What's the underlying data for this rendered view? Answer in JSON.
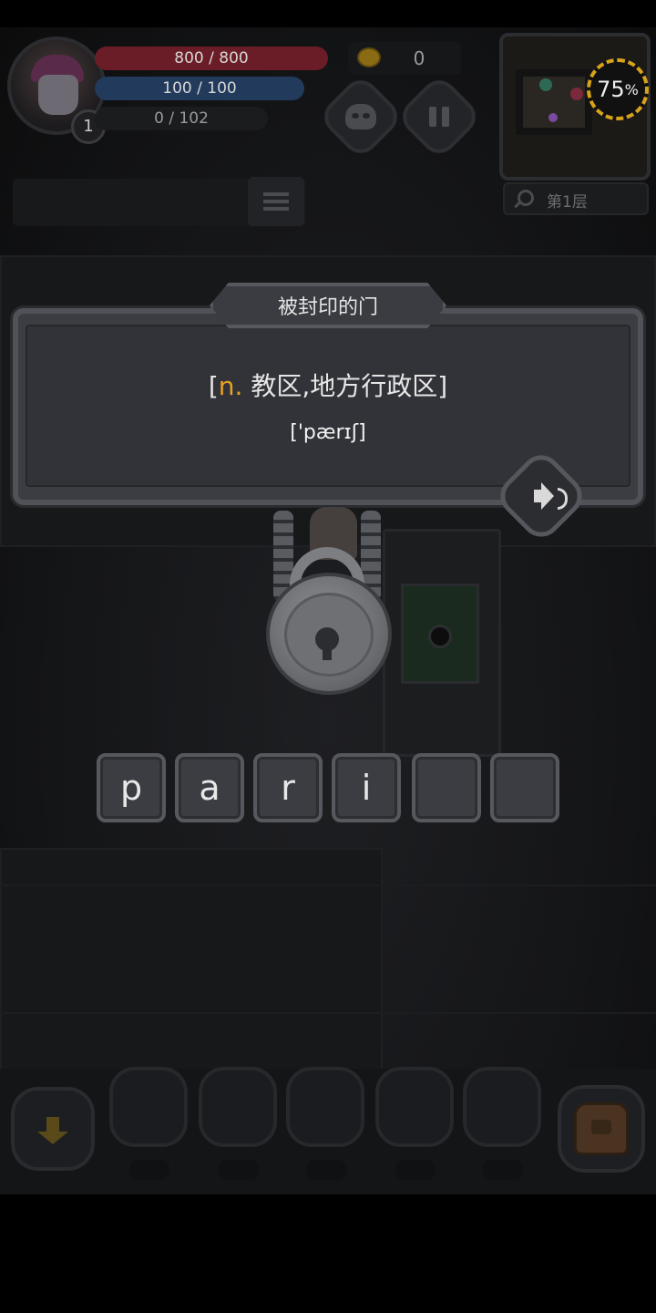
{
  "hud": {
    "hp": "800 / 800",
    "mp": "100 / 100",
    "xp": "0 / 102",
    "level": "1",
    "gold": "0",
    "progress_value": "75",
    "progress_unit": "%",
    "floor": "第1层"
  },
  "dialog": {
    "title": "被封印的门",
    "bracket_open": "[",
    "part_of_speech": "n.",
    "meaning": " 教区,地方行政区",
    "bracket_close": "]",
    "phonetic": "['pærɪʃ]"
  },
  "word_tiles": [
    {
      "letter": "p"
    },
    {
      "letter": "a"
    },
    {
      "letter": "r"
    },
    {
      "letter": "i"
    },
    {
      "letter": ""
    },
    {
      "letter": ""
    }
  ],
  "colors": {
    "part_of_speech": "#e6a224",
    "hp": "#6a1d26",
    "mp": "#223a5c",
    "progress_ring": "#d7a21c"
  },
  "icons": [
    "pet-icon",
    "pause-icon",
    "search-icon",
    "menu-icon",
    "speaker-icon",
    "lock-icon",
    "arrow-down-icon",
    "backpack-icon"
  ]
}
